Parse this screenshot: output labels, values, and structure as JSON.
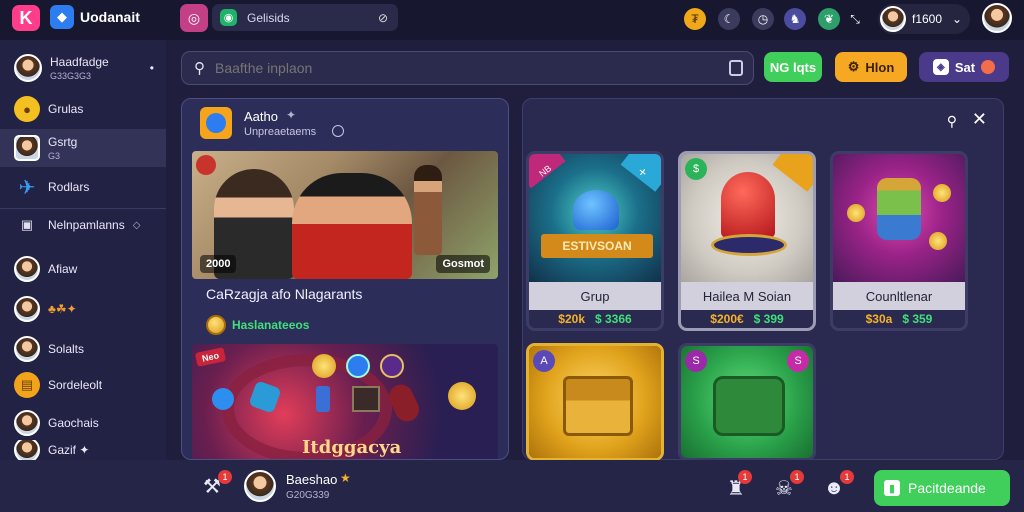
{
  "app": {
    "title": "Uodanait",
    "logo_glyph": "K",
    "colors": {
      "accent_pink": "#ff3d8a",
      "green": "#3fcf5a",
      "orange": "#f7a823",
      "purple": "#5a3fa8",
      "bg": "#1b1b3a"
    }
  },
  "topbar": {
    "tab_label": "Gelisids",
    "tab_close": "⊘",
    "right_icons": [
      "coin-icon",
      "moon-icon",
      "clock-icon",
      "people-icon",
      "leaf-icon",
      "expand-icon"
    ],
    "user_balance": "f1600",
    "user_caret": "⌄"
  },
  "sidebar": {
    "items": [
      {
        "label": "Haadfadge",
        "sub": "G33G3G3",
        "dot": "•"
      },
      {
        "label": "Grulas"
      },
      {
        "label": "Gsrtg",
        "sub": "G3"
      },
      {
        "label": "Rodlars"
      },
      {
        "label": "Nelnpamlanns",
        "suffix": "◇"
      },
      {
        "label": "Afiaw"
      },
      {
        "label": "♣☘✦"
      },
      {
        "label": "Solalts"
      },
      {
        "label": "Sordeleolt"
      },
      {
        "label": "Gaochais"
      },
      {
        "label": "Gazif ✦"
      }
    ]
  },
  "search": {
    "placeholder": "Baafthe inplaon",
    "value": ""
  },
  "toolbar": {
    "btn1_label": "NG lqts",
    "btn2_label": "Hlon",
    "btn3_label": "Sat"
  },
  "left_card": {
    "title": "Aatho",
    "title_star": "✦",
    "subtitle": "Unpreaetaems",
    "hero_left_tag": "2000",
    "hero_right_tag": "Gosmot",
    "caption": "CaRzagja afo Nlagarants",
    "sub_label": "Haslanateeos",
    "promo_tag": "Neo",
    "promo_title": "Itdggacya"
  },
  "right_panel": {
    "tiles": [
      {
        "label": "Grup",
        "price": "$20k",
        "alt_price": "$ 3366",
        "banner": "ESTIVSOAN",
        "corner_tag": "NB"
      },
      {
        "label": "Hailea M Soian",
        "price": "$200€",
        "alt_price": "$ 399",
        "corner_tag": "$"
      },
      {
        "label": "Counltlenar",
        "price": "$30a",
        "alt_price": "$ 359"
      },
      {
        "label": "",
        "price": "",
        "alt_price": "",
        "corner_tag": "A"
      },
      {
        "label": "",
        "price": "",
        "alt_price": "",
        "corner_tag": "S",
        "right_tag": "S"
      }
    ]
  },
  "bottombar": {
    "user_name": "Baeshao",
    "user_star": "★",
    "user_sub": "G20G339",
    "badges": [
      "1",
      "1",
      "1",
      "1"
    ],
    "cta_label": "Pacitdeande"
  }
}
